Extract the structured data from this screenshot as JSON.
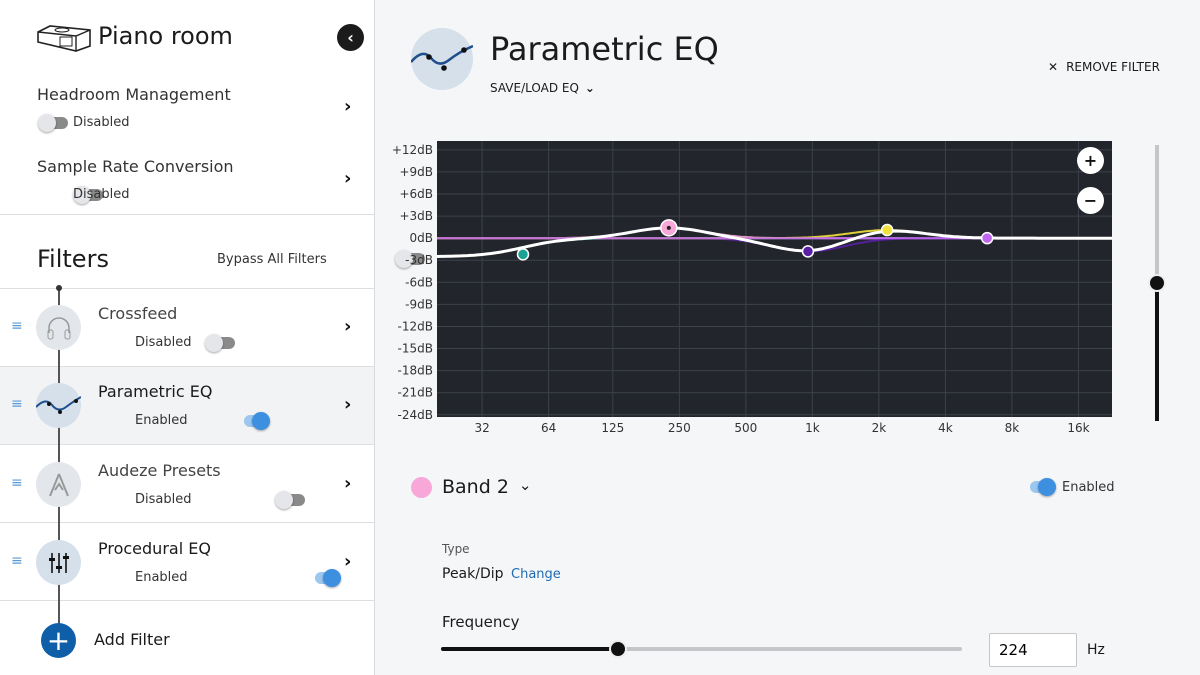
{
  "sidebar": {
    "room_name": "Piano room",
    "settings": [
      {
        "label": "Headroom Management",
        "status": "Disabled",
        "enabled": false
      },
      {
        "label": "Sample Rate Conversion",
        "status": "Disabled",
        "enabled": false
      }
    ],
    "filters_title": "Filters",
    "bypass_label": "Bypass All Filters",
    "bypass_on": false,
    "filters": [
      {
        "name": "Crossfeed",
        "status": "Disabled",
        "enabled": false,
        "icon": "headphones-icon"
      },
      {
        "name": "Parametric EQ",
        "status": "Enabled",
        "enabled": true,
        "icon": "eq-curve-icon",
        "selected": true
      },
      {
        "name": "Audeze Presets",
        "status": "Disabled",
        "enabled": false,
        "icon": "audeze-logo-icon"
      },
      {
        "name": "Procedural EQ",
        "status": "Enabled",
        "enabled": true,
        "icon": "sliders-icon"
      }
    ],
    "add_filter_label": "Add Filter"
  },
  "main": {
    "title": "Parametric EQ",
    "save_load_label": "SAVE/LOAD EQ",
    "remove_label": "REMOVE FILTER",
    "zoom_in": "+",
    "zoom_out": "−",
    "gain_slider_level": 0.5,
    "band": {
      "name": "Band 2",
      "color": "#f7a8d8",
      "enabled_label": "Enabled",
      "enabled": true,
      "type_label": "Type",
      "type_value": "Peak/Dip",
      "change_label": "Change",
      "frequency_label": "Frequency",
      "frequency_value": "224",
      "frequency_unit": "Hz",
      "frequency_slider_level": 0.34
    }
  },
  "chart_data": {
    "type": "line",
    "y_ticks": [
      "+12dB",
      "+9dB",
      "+6dB",
      "+3dB",
      "0dB",
      "-3dB",
      "-6dB",
      "-9dB",
      "-12dB",
      "-15dB",
      "-18dB",
      "-21dB",
      "-24dB"
    ],
    "y_tick_values": [
      12,
      9,
      6,
      3,
      0,
      -3,
      -6,
      -9,
      -12,
      -15,
      -18,
      -21,
      -24
    ],
    "x_ticks": [
      "32",
      "64",
      "125",
      "250",
      "500",
      "1k",
      "2k",
      "4k",
      "8k",
      "16k"
    ],
    "x_tick_values": [
      32,
      64,
      125,
      250,
      500,
      1000,
      2000,
      4000,
      8000,
      16000
    ],
    "xlim": [
      20,
      22700
    ],
    "ylim": [
      -24.3,
      13.2
    ],
    "x_scale": "log",
    "grid": true,
    "background": "#22252c",
    "bands": [
      {
        "freq": 49,
        "gain": -2.2,
        "color": "#1aa394",
        "shape": "shelf"
      },
      {
        "freq": 224,
        "gain": 1.4,
        "color": "#f7a8d8",
        "shape": "peak",
        "selected": true
      },
      {
        "freq": 955,
        "gain": -1.8,
        "color": "#5a1fa6",
        "shape": "peak"
      },
      {
        "freq": 2180,
        "gain": 1.1,
        "color": "#f2e33a",
        "shape": "peak"
      },
      {
        "freq": 6180,
        "gain": 0,
        "color": "#c065f0",
        "shape": "peak"
      }
    ]
  }
}
